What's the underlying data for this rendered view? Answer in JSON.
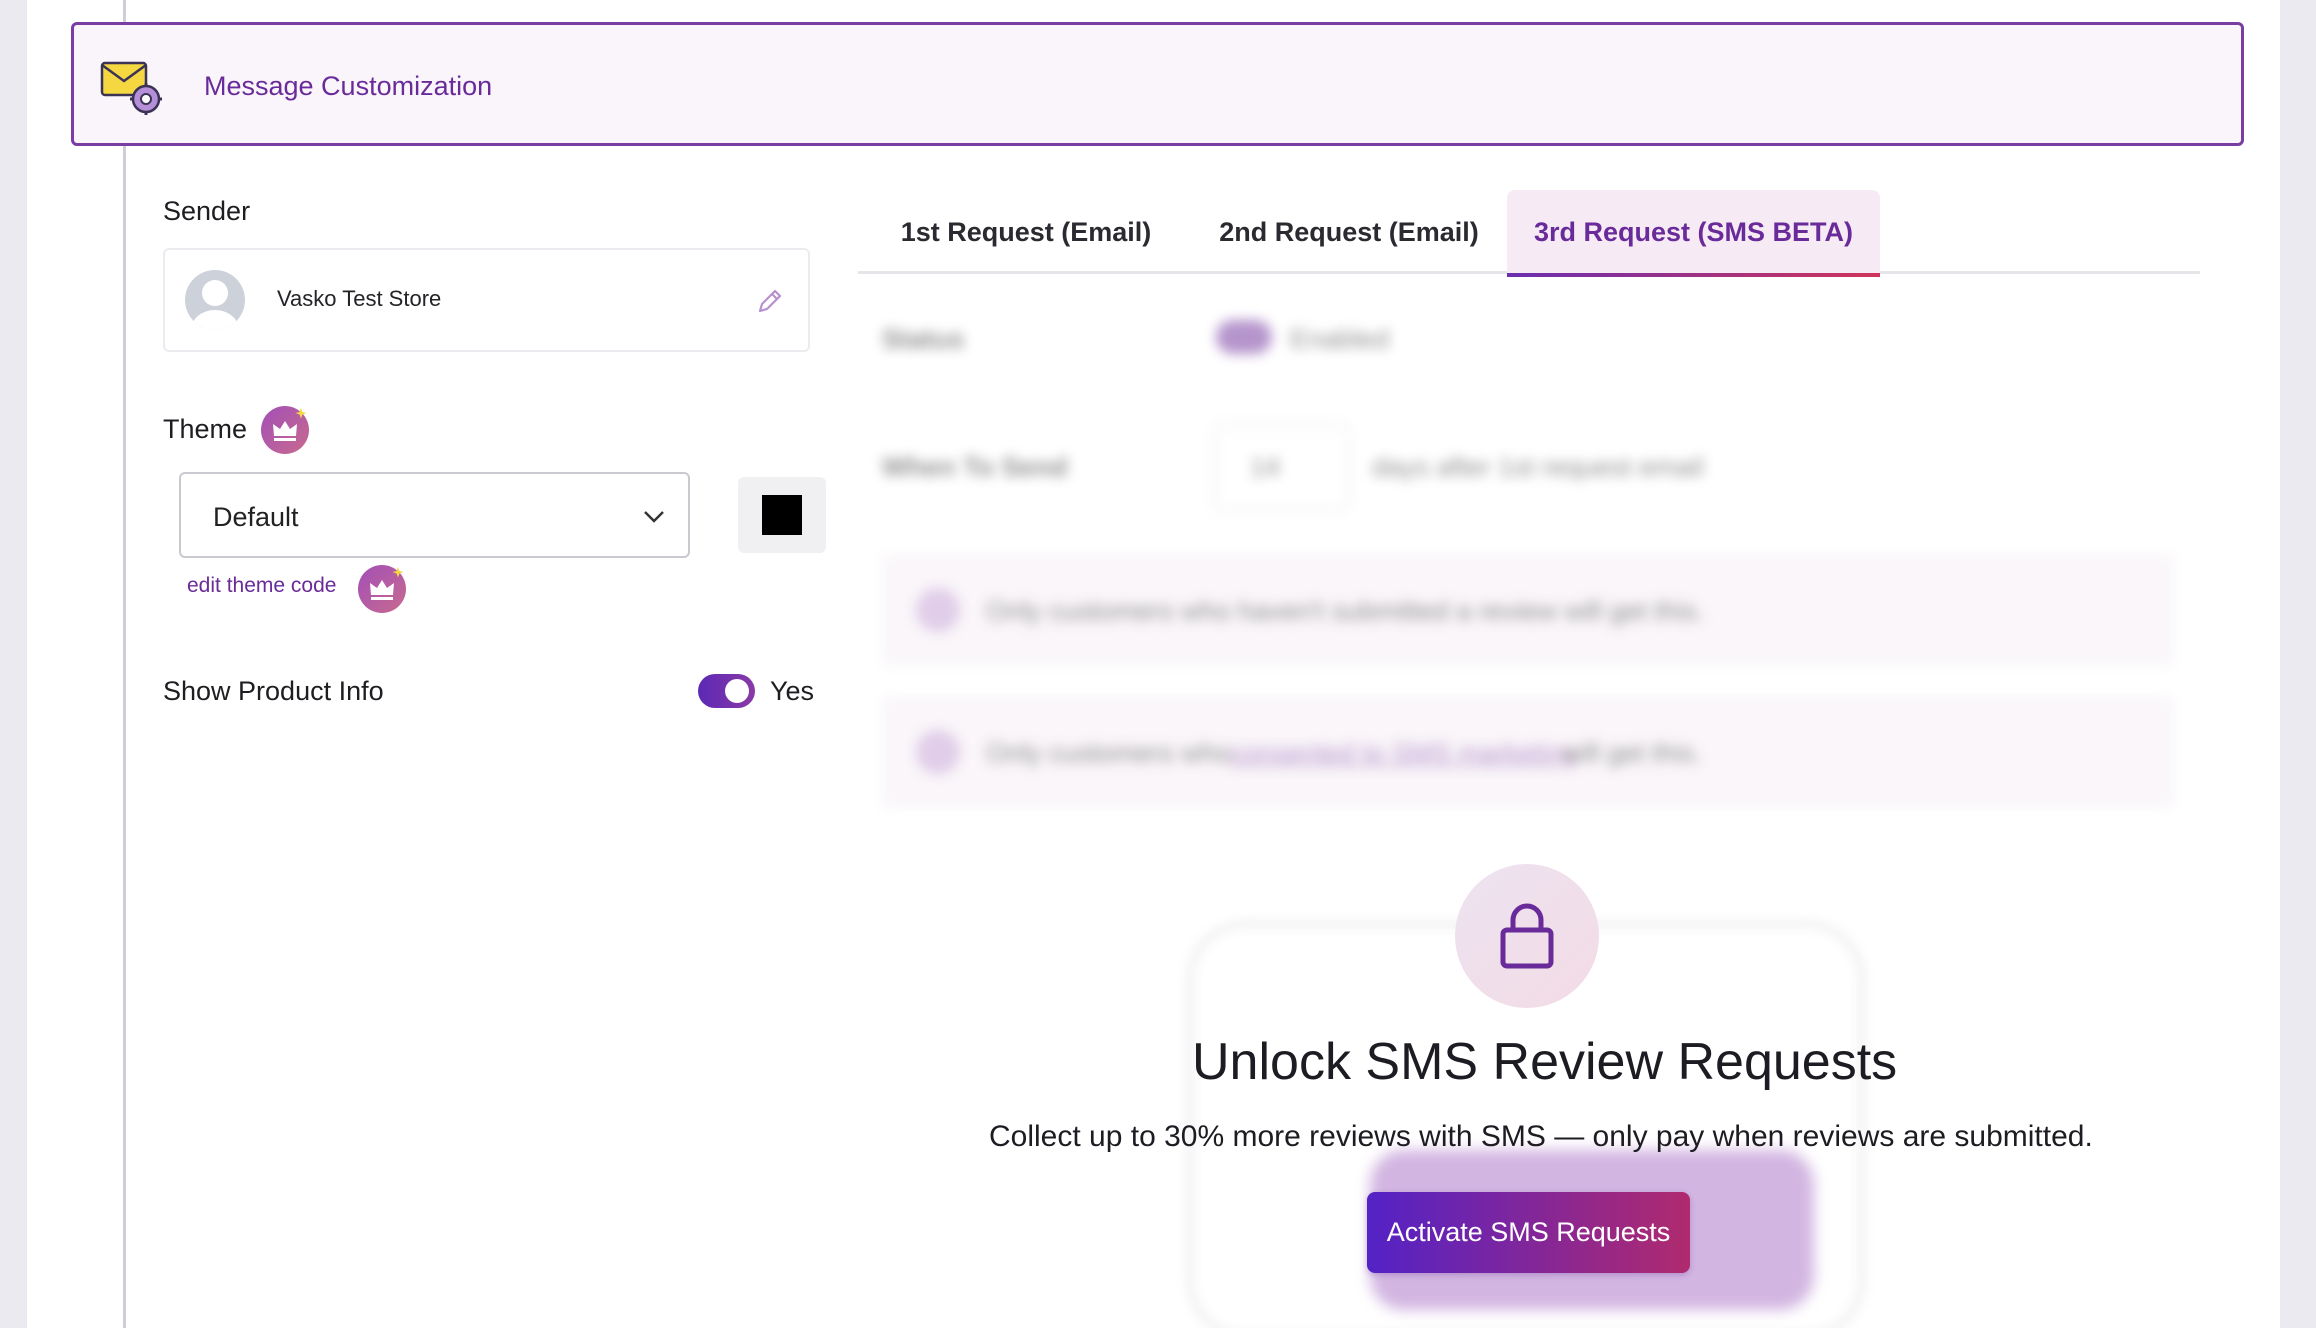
{
  "section": {
    "title": "Message Customization"
  },
  "sender": {
    "label": "Sender",
    "name": "Vasko Test Store"
  },
  "theme": {
    "label": "Theme",
    "selected": "Default",
    "edit_link": "edit theme code",
    "color": "#000000"
  },
  "product_info": {
    "label": "Show Product Info",
    "toggle_value": "Yes",
    "enabled": true
  },
  "tabs": [
    {
      "label": "1st Request (Email)",
      "active": false
    },
    {
      "label": "2nd Request (Email)",
      "active": false
    },
    {
      "label": "3rd Request (SMS BETA)",
      "active": true
    }
  ],
  "locked": {
    "status_label": "Status",
    "status_value": "Enabled",
    "when_label": "When To Send",
    "when_value": "14",
    "when_suffix": "days after 1st request email",
    "note_1": "Only customers who haven't submitted a review will get this.",
    "note_2_prefix": "Only customers who",
    "note_2_link": "consented to SMS marketing",
    "note_2_suffix": "will get this."
  },
  "unlock": {
    "title": "Unlock SMS Review Requests",
    "subtitle": "Collect up to 30% more reviews with SMS — only pay when reviews are submitted.",
    "cta": "Activate SMS Requests"
  },
  "colors": {
    "accent": "#6a2b9a",
    "cta_start": "#5322c6",
    "cta_end": "#b02a6e"
  }
}
